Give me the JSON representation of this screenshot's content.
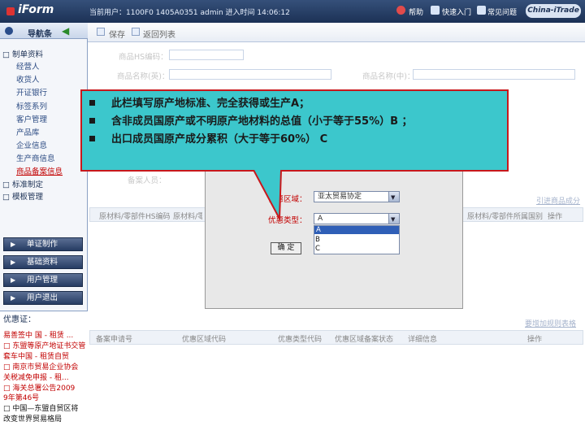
{
  "topbar": {
    "logo": "iForm",
    "login_info": "当前用户：1100F0  1405A0351  admin   进入时间 14:06:12",
    "links": [
      "帮助",
      "快速入门",
      "常见问题"
    ],
    "brand": "China-iTrade"
  },
  "sidebar": {
    "title": "导航条",
    "tree": [
      {
        "label": "□ 制单资料",
        "level": 0
      },
      {
        "label": "经营人",
        "level": 1
      },
      {
        "label": "收货人",
        "level": 1
      },
      {
        "label": "开证银行",
        "level": 1
      },
      {
        "label": "标签系列",
        "level": 1
      },
      {
        "label": "客户管理",
        "level": 1
      },
      {
        "label": "产品库",
        "level": 1
      },
      {
        "label": "企业信息",
        "level": 1
      },
      {
        "label": "生产商信息",
        "level": 1
      },
      {
        "label": "商品备案信息",
        "level": 1,
        "active": true
      },
      {
        "label": "□ 标准制定",
        "level": 0
      },
      {
        "label": "□ 模板管理",
        "level": 0
      }
    ],
    "nav_buttons": [
      "单证制作",
      "基础资料",
      "用户管理",
      "用户退出"
    ],
    "notice_title": "优惠证：",
    "notices": [
      {
        "text": "易善签中 国 - 租赁 ...",
        "dark": false
      },
      {
        "text": "□ 东盟等原产地证书交管",
        "dark": false
      },
      {
        "text": "套车中国 - 租赁自贸",
        "dark": false
      },
      {
        "text": "□ 南京市贸易企业协会",
        "dark": false
      },
      {
        "text": "关税减免申报 -  租...",
        "dark": false
      },
      {
        "text": "□ 海关总署公告2009",
        "dark": false
      },
      {
        "text": "9年第46号",
        "dark": false
      },
      {
        "text": "□ 中国—东盟自贸区将",
        "dark": true
      },
      {
        "text": "改变世界贸易格局",
        "dark": true
      }
    ]
  },
  "toolbar": {
    "save": "保存",
    "back": "返回列表"
  },
  "form": {
    "hs_code_label": "商品HS编码：",
    "name_en_label": "商品名称(英)：",
    "name_cn_label": "商品名称(中)：",
    "remark_label": "备案人员："
  },
  "table1": {
    "right_link": "引进商品成分",
    "headers": [
      "原材料/零部件HS编码",
      "原材料/零部件",
      "原材料/零部件所属国别",
      "操作"
    ]
  },
  "table2": {
    "right_link": "要增加规则表格",
    "headers": [
      "备案申请号",
      "优惠区域代码",
      "优惠类型代码",
      "优惠区域备案状态",
      "详细信息",
      "操作"
    ]
  },
  "dialog": {
    "region_label": "优惠区域：",
    "region_value": "亚太贸易协定",
    "type_label": "优惠类型：",
    "type_value": "A",
    "type_options": [
      "A",
      "B",
      "C"
    ],
    "ok": "确 定"
  },
  "callout": {
    "lines": [
      "此栏填写原产地标准、完全获得或生产A；",
      "含非成员国原产或不明原产地材料的总值（小于等于55%）B ；",
      "出口成员国原产成分累积（大于等于60%） C"
    ]
  },
  "colors": {
    "callout_bg": "#3cc7cc",
    "callout_border": "#c8181c",
    "topbar": "#1c3155",
    "accent_red": "#c20000"
  }
}
